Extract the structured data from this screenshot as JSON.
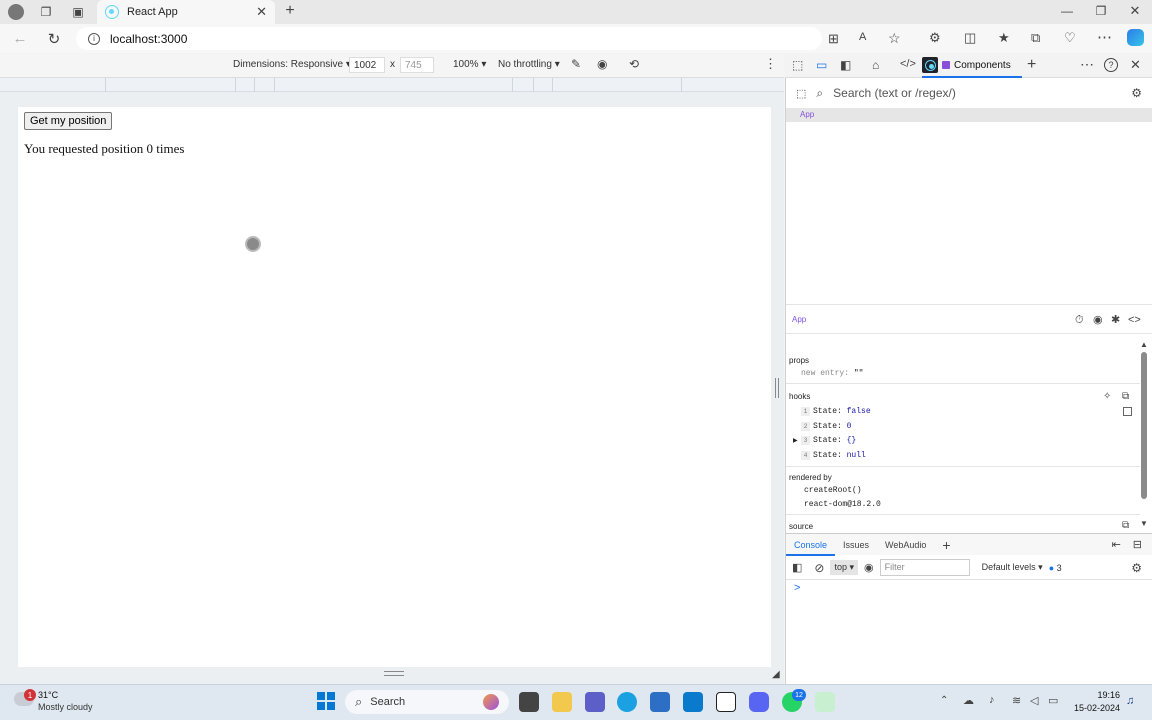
{
  "browser": {
    "tab_title": "React App",
    "url": "localhost:3000"
  },
  "device_toolbar": {
    "dimensions_label": "Dimensions: Responsive",
    "width": "1002",
    "height": "745",
    "separator": "x",
    "zoom": "100%",
    "throttling": "No throttling"
  },
  "page": {
    "button_label": "Get my position",
    "text": "You requested position 0 times"
  },
  "devtools": {
    "active_tab": "Components",
    "search_placeholder": "Search (text or /regex/)",
    "tree_item": "App",
    "selected_component": "App",
    "props_label": "props",
    "prop_name": "new entry:",
    "prop_value": "\"\"",
    "hooks_label": "hooks",
    "hooks": [
      {
        "index": "1",
        "label": "State:",
        "value": "false"
      },
      {
        "index": "2",
        "label": "State:",
        "value": "0"
      },
      {
        "index": "3",
        "label": "State:",
        "value": "{}"
      },
      {
        "index": "4",
        "label": "State:",
        "value": "null"
      }
    ],
    "rendered_by_label": "rendered by",
    "rendered_by": [
      "createRoot()",
      "react-dom@18.2.0"
    ],
    "source_label": "source"
  },
  "console": {
    "tabs": [
      "Console",
      "Issues",
      "WebAudio"
    ],
    "context": "top",
    "filter_placeholder": "Filter",
    "levels": "Default levels",
    "issue_count": "3",
    "prompt": ">"
  },
  "taskbar": {
    "weather_badge": "1",
    "temperature": "31°C",
    "weather": "Mostly cloudy",
    "search_label": "Search",
    "teams_badge": "12",
    "time": "19:16",
    "date": "15-02-2024"
  }
}
